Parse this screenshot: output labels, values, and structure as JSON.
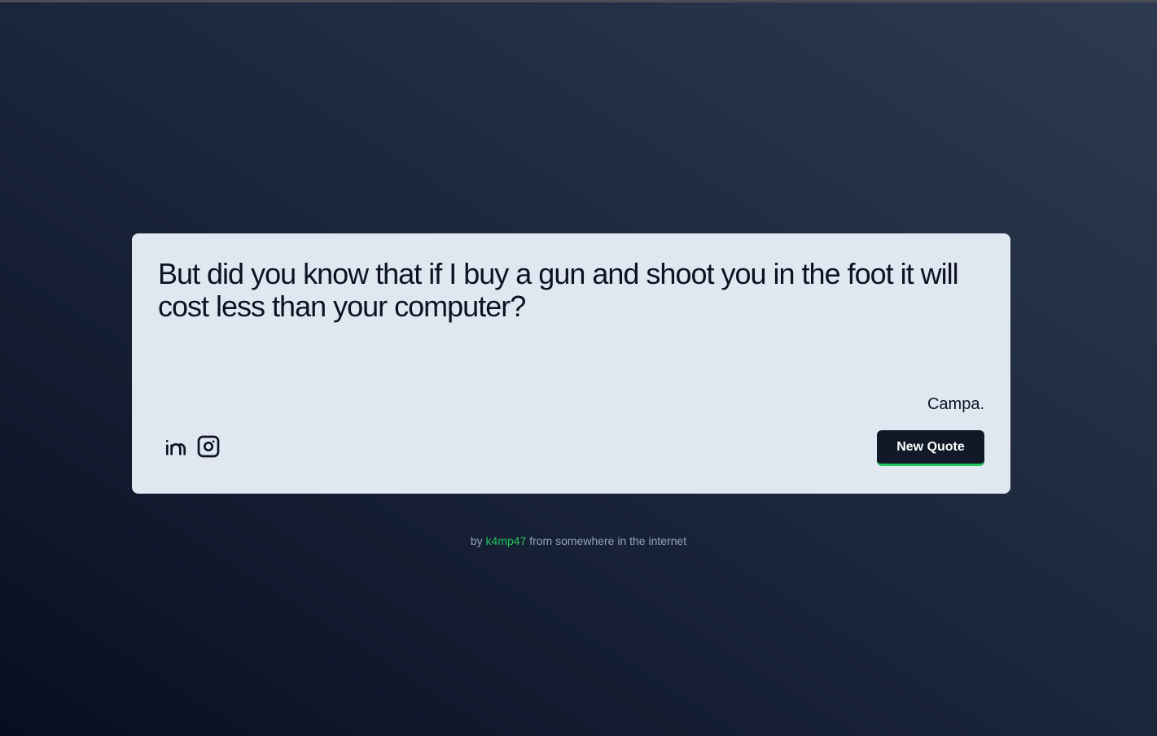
{
  "quote": {
    "text": "But did you know that if I buy a gun and shoot you in the foot it will cost less than your computer?",
    "author": "Campa."
  },
  "socials": [
    {
      "icon": "linkedin-icon"
    },
    {
      "icon": "instagram-icon"
    }
  ],
  "actions": {
    "new_quote_label": "New Quote"
  },
  "footer": {
    "prefix": "by",
    "author_link": "k4mp47",
    "suffix": "from somewhere in the internet"
  },
  "colors": {
    "card_background": "#e1e7f0",
    "button_background": "#111827",
    "accent": "#22c55e",
    "footer_text": "#94a3b8"
  }
}
